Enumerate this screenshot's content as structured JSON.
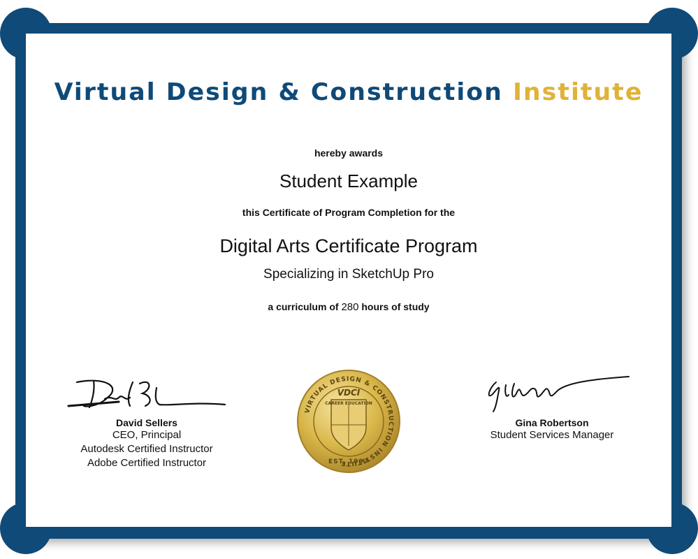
{
  "header": {
    "title_main": "Virtual Design & Construction",
    "title_accent": "Institute"
  },
  "body": {
    "awards_text": "hereby awards",
    "recipient": "Student Example",
    "certificate_line": "this Certificate of Program Completion for the",
    "program": "Digital Arts Certificate Program",
    "specialization": "Specializing in SketchUp Pro",
    "curriculum_prefix": "a curriculum of",
    "hours": "280",
    "curriculum_suffix": "hours of study"
  },
  "signatories": {
    "left": {
      "name": "David Sellers",
      "lines": [
        "CEO, Principal",
        "Autodesk Certified Instructor",
        "Adobe Certified Instructor"
      ]
    },
    "right": {
      "name": "Gina Robertson",
      "lines": [
        "Student Services Manager"
      ]
    }
  },
  "seal": {
    "ring_text": "VIRTUAL DESIGN & CONSTRUCTION INSTITUTE",
    "logo": "VDCI",
    "banner": "CAREER EDUCATION",
    "established": "EST. 1997"
  },
  "colors": {
    "frame": "#0f4a78",
    "accent": "#e0b238",
    "seal_gold": "#d9b74a"
  }
}
